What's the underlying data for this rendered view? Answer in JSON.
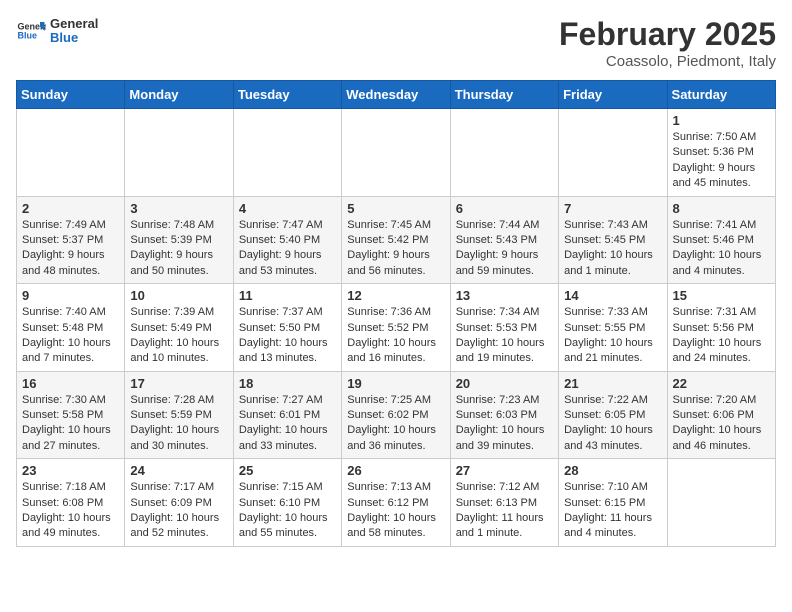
{
  "logo": {
    "text_general": "General",
    "text_blue": "Blue"
  },
  "header": {
    "month": "February 2025",
    "location": "Coassolo, Piedmont, Italy"
  },
  "weekdays": [
    "Sunday",
    "Monday",
    "Tuesday",
    "Wednesday",
    "Thursday",
    "Friday",
    "Saturday"
  ],
  "weeks": [
    [
      {
        "day": "",
        "info": ""
      },
      {
        "day": "",
        "info": ""
      },
      {
        "day": "",
        "info": ""
      },
      {
        "day": "",
        "info": ""
      },
      {
        "day": "",
        "info": ""
      },
      {
        "day": "",
        "info": ""
      },
      {
        "day": "1",
        "info": "Sunrise: 7:50 AM\nSunset: 5:36 PM\nDaylight: 9 hours and 45 minutes."
      }
    ],
    [
      {
        "day": "2",
        "info": "Sunrise: 7:49 AM\nSunset: 5:37 PM\nDaylight: 9 hours and 48 minutes."
      },
      {
        "day": "3",
        "info": "Sunrise: 7:48 AM\nSunset: 5:39 PM\nDaylight: 9 hours and 50 minutes."
      },
      {
        "day": "4",
        "info": "Sunrise: 7:47 AM\nSunset: 5:40 PM\nDaylight: 9 hours and 53 minutes."
      },
      {
        "day": "5",
        "info": "Sunrise: 7:45 AM\nSunset: 5:42 PM\nDaylight: 9 hours and 56 minutes."
      },
      {
        "day": "6",
        "info": "Sunrise: 7:44 AM\nSunset: 5:43 PM\nDaylight: 9 hours and 59 minutes."
      },
      {
        "day": "7",
        "info": "Sunrise: 7:43 AM\nSunset: 5:45 PM\nDaylight: 10 hours and 1 minute."
      },
      {
        "day": "8",
        "info": "Sunrise: 7:41 AM\nSunset: 5:46 PM\nDaylight: 10 hours and 4 minutes."
      }
    ],
    [
      {
        "day": "9",
        "info": "Sunrise: 7:40 AM\nSunset: 5:48 PM\nDaylight: 10 hours and 7 minutes."
      },
      {
        "day": "10",
        "info": "Sunrise: 7:39 AM\nSunset: 5:49 PM\nDaylight: 10 hours and 10 minutes."
      },
      {
        "day": "11",
        "info": "Sunrise: 7:37 AM\nSunset: 5:50 PM\nDaylight: 10 hours and 13 minutes."
      },
      {
        "day": "12",
        "info": "Sunrise: 7:36 AM\nSunset: 5:52 PM\nDaylight: 10 hours and 16 minutes."
      },
      {
        "day": "13",
        "info": "Sunrise: 7:34 AM\nSunset: 5:53 PM\nDaylight: 10 hours and 19 minutes."
      },
      {
        "day": "14",
        "info": "Sunrise: 7:33 AM\nSunset: 5:55 PM\nDaylight: 10 hours and 21 minutes."
      },
      {
        "day": "15",
        "info": "Sunrise: 7:31 AM\nSunset: 5:56 PM\nDaylight: 10 hours and 24 minutes."
      }
    ],
    [
      {
        "day": "16",
        "info": "Sunrise: 7:30 AM\nSunset: 5:58 PM\nDaylight: 10 hours and 27 minutes."
      },
      {
        "day": "17",
        "info": "Sunrise: 7:28 AM\nSunset: 5:59 PM\nDaylight: 10 hours and 30 minutes."
      },
      {
        "day": "18",
        "info": "Sunrise: 7:27 AM\nSunset: 6:01 PM\nDaylight: 10 hours and 33 minutes."
      },
      {
        "day": "19",
        "info": "Sunrise: 7:25 AM\nSunset: 6:02 PM\nDaylight: 10 hours and 36 minutes."
      },
      {
        "day": "20",
        "info": "Sunrise: 7:23 AM\nSunset: 6:03 PM\nDaylight: 10 hours and 39 minutes."
      },
      {
        "day": "21",
        "info": "Sunrise: 7:22 AM\nSunset: 6:05 PM\nDaylight: 10 hours and 43 minutes."
      },
      {
        "day": "22",
        "info": "Sunrise: 7:20 AM\nSunset: 6:06 PM\nDaylight: 10 hours and 46 minutes."
      }
    ],
    [
      {
        "day": "23",
        "info": "Sunrise: 7:18 AM\nSunset: 6:08 PM\nDaylight: 10 hours and 49 minutes."
      },
      {
        "day": "24",
        "info": "Sunrise: 7:17 AM\nSunset: 6:09 PM\nDaylight: 10 hours and 52 minutes."
      },
      {
        "day": "25",
        "info": "Sunrise: 7:15 AM\nSunset: 6:10 PM\nDaylight: 10 hours and 55 minutes."
      },
      {
        "day": "26",
        "info": "Sunrise: 7:13 AM\nSunset: 6:12 PM\nDaylight: 10 hours and 58 minutes."
      },
      {
        "day": "27",
        "info": "Sunrise: 7:12 AM\nSunset: 6:13 PM\nDaylight: 11 hours and 1 minute."
      },
      {
        "day": "28",
        "info": "Sunrise: 7:10 AM\nSunset: 6:15 PM\nDaylight: 11 hours and 4 minutes."
      },
      {
        "day": "",
        "info": ""
      }
    ]
  ]
}
